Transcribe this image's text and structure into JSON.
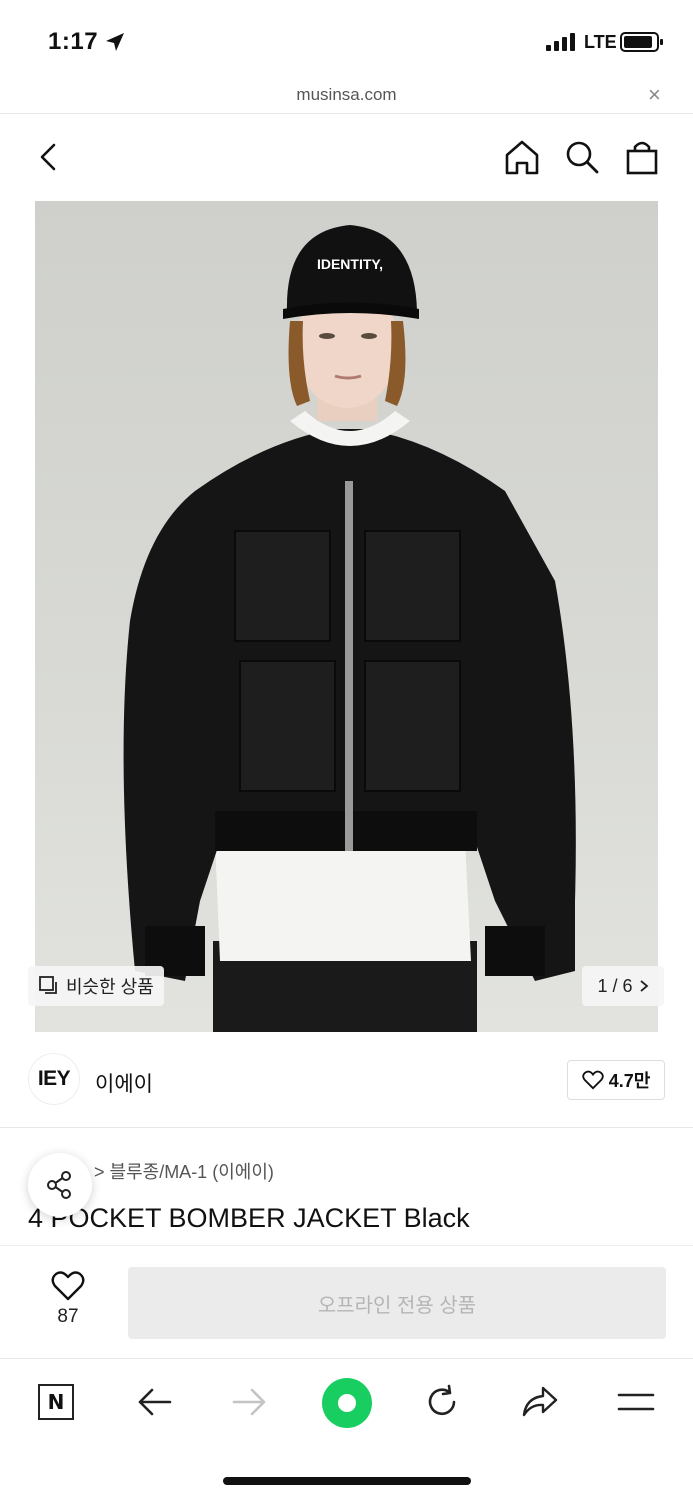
{
  "status_bar": {
    "time": "1:17",
    "carrier": "LTE"
  },
  "browser": {
    "url": "musinsa.com",
    "close_label": "×"
  },
  "nav": {
    "back": "back",
    "home": "home",
    "search": "search",
    "cart": "cart"
  },
  "hero": {
    "cap_text": "IDENTITY,",
    "similar_label": "비슷한 상품",
    "pager": "1 / 6"
  },
  "brand": {
    "logo": "IEY",
    "name": "이에이",
    "likes": "4.7만"
  },
  "product": {
    "breadcrumb": "> 블루종/MA-1 (이에이)",
    "title": "4 POCKET BOMBER JACKET Black"
  },
  "purchase": {
    "wish_count": "87",
    "offline_label": "오프라인 전용 상품"
  },
  "colors": {
    "accent_green": "#19ce60",
    "disabled_bg": "#ebebeb"
  }
}
